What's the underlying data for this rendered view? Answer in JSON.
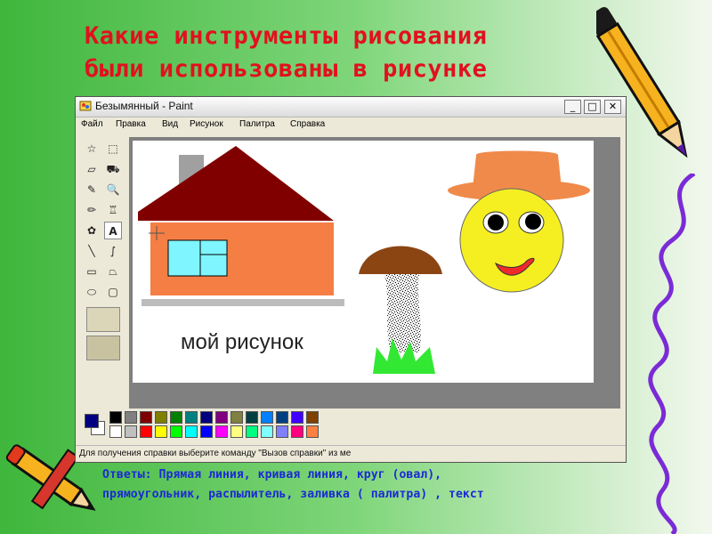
{
  "slide": {
    "title_lines": [
      "Какие инструменты рисования",
      "были использованы в рисунке"
    ],
    "answer_lines": [
      "Ответы: Прямая линия, кривая линия, круг (овал),",
      "прямоугольник, распылитель, заливка ( палитра) , текст"
    ]
  },
  "window": {
    "title": "Безымянный - Paint",
    "buttons": {
      "minimize": "_",
      "maximize": "□",
      "close": "✕"
    },
    "menu": [
      "Файл",
      "Правка",
      "Вид",
      "Рисунок",
      "Палитра",
      "Справка"
    ],
    "status": "Для получения справки выберите команду \"Вызов справки\" из ме"
  },
  "tools": [
    {
      "name": "free-select-icon",
      "glyph": "☆"
    },
    {
      "name": "rect-select-icon",
      "glyph": "⬚"
    },
    {
      "name": "eraser-icon",
      "glyph": "▱"
    },
    {
      "name": "fill-icon",
      "glyph": "⛟"
    },
    {
      "name": "color-picker-icon",
      "glyph": "✎"
    },
    {
      "name": "magnifier-icon",
      "glyph": "🔍"
    },
    {
      "name": "pencil-icon",
      "glyph": "✏"
    },
    {
      "name": "brush-icon",
      "glyph": "♖"
    },
    {
      "name": "airbrush-icon",
      "glyph": "✿"
    },
    {
      "name": "text-icon",
      "glyph": "A"
    },
    {
      "name": "line-icon",
      "glyph": "╲"
    },
    {
      "name": "curve-icon",
      "glyph": "∫"
    },
    {
      "name": "rectangle-icon",
      "glyph": "▭"
    },
    {
      "name": "polygon-icon",
      "glyph": "⏢"
    },
    {
      "name": "ellipse-icon",
      "glyph": "⬭"
    },
    {
      "name": "rounded-rect-icon",
      "glyph": "▢"
    }
  ],
  "drawing": {
    "caption": "мой рисунок",
    "colors": {
      "house_wall": "#f57e44",
      "roof": "#800000",
      "window": "#7ff6ff",
      "chimney": "#a0a0a0",
      "hat": "#f08a4a",
      "face": "#f5ef22",
      "mouth": "#f02a2a",
      "mushroom_cap": "#8b4513",
      "grass": "#33e833"
    }
  },
  "palette": {
    "foreground": "#000080",
    "background": "#ffffff",
    "row1": [
      "#000000",
      "#808080",
      "#800000",
      "#808000",
      "#008000",
      "#008080",
      "#000080",
      "#800080",
      "#808040",
      "#004040",
      "#0080ff",
      "#004080",
      "#4000ff",
      "#804000"
    ],
    "row2": [
      "#ffffff",
      "#c0c0c0",
      "#ff0000",
      "#ffff00",
      "#00ff00",
      "#00ffff",
      "#0000ff",
      "#ff00ff",
      "#ffff80",
      "#00ff80",
      "#80ffff",
      "#8080ff",
      "#ff0080",
      "#ff8040"
    ]
  }
}
